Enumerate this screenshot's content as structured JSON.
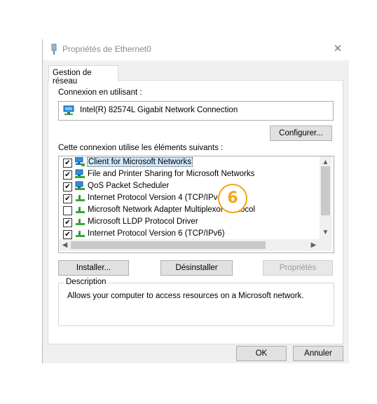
{
  "window": {
    "title": "Propriétés de Ethernet0",
    "close_glyph": "✕"
  },
  "tab": {
    "label": "Gestion de réseau"
  },
  "connect_using": {
    "label": "Connexion en utilisant :",
    "adapter": "Intel(R) 82574L Gigabit Network Connection",
    "configure_button": "Configurer..."
  },
  "items_section": {
    "label": "Cette connexion utilise les éléments suivants :",
    "items": [
      {
        "label": "Client for Microsoft Networks",
        "checked": true,
        "icon": "network-client-icon",
        "selected": true
      },
      {
        "label": "File and Printer Sharing for Microsoft Networks",
        "checked": true,
        "icon": "network-service-icon"
      },
      {
        "label": "QoS Packet Scheduler",
        "checked": true,
        "icon": "network-service-icon"
      },
      {
        "label": "Internet Protocol Version 4 (TCP/IPv4)",
        "checked": true,
        "icon": "protocol-icon"
      },
      {
        "label": "Microsoft Network Adapter Multiplexor Protocol",
        "checked": false,
        "icon": "protocol-icon"
      },
      {
        "label": "Microsoft LLDP Protocol Driver",
        "checked": true,
        "icon": "protocol-icon"
      },
      {
        "label": "Internet Protocol Version 6 (TCP/IPv6)",
        "checked": true,
        "icon": "protocol-icon"
      }
    ],
    "install_button": "Installer...",
    "uninstall_button": "Désinstaller",
    "properties_button": "Propriétés"
  },
  "description": {
    "legend": "Description",
    "text": "Allows your computer to access resources on a Microsoft network."
  },
  "footer": {
    "ok_button": "OK",
    "cancel_button": "Annuler"
  },
  "annotation": {
    "step_number": "6",
    "color": "#f5a31a"
  },
  "colors": {
    "accent": "#0078d7",
    "selection": "#cce8ff"
  }
}
